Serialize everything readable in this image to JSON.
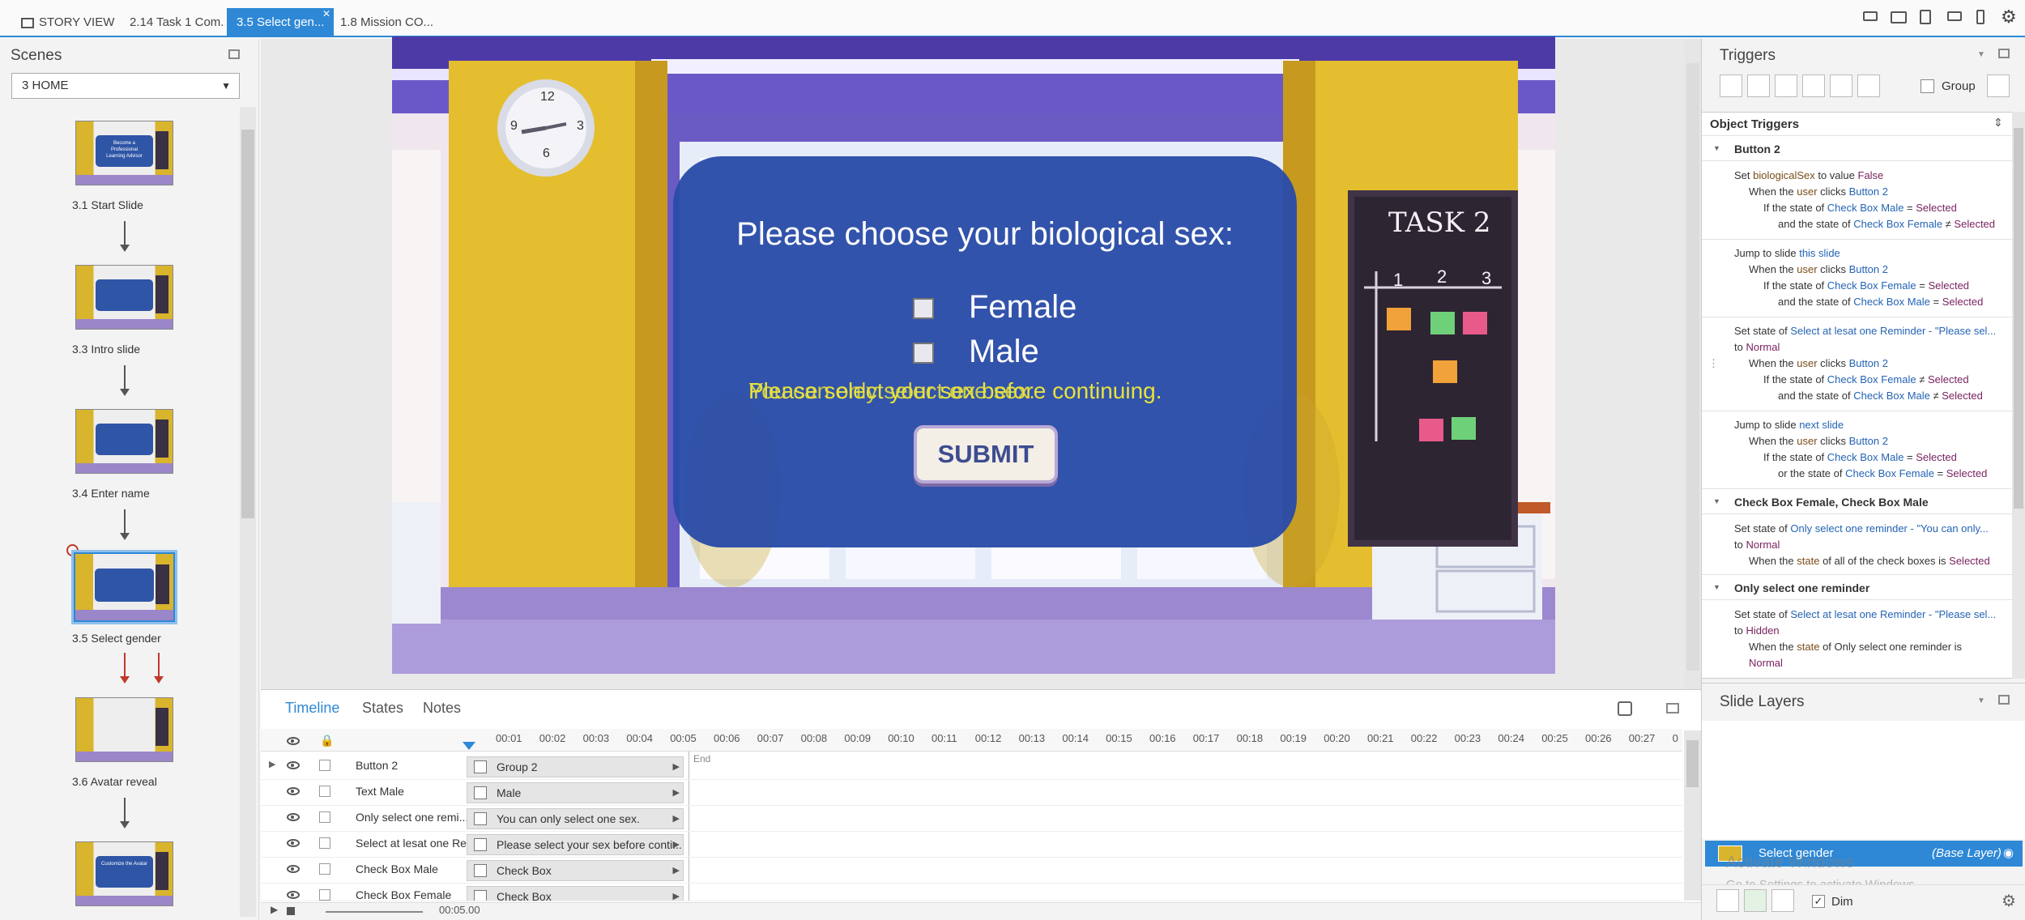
{
  "tabs": [
    {
      "label": "STORY VIEW"
    },
    {
      "label": "2.14 Task 1 Com..."
    },
    {
      "label": "3.5 Select gen..."
    },
    {
      "label": "1.8 Mission CO..."
    }
  ],
  "scenes": {
    "title": "Scenes",
    "dropdown_value": "3 HOME",
    "slides": [
      {
        "label": "3.1 Start Slide"
      },
      {
        "label": "3.3 Intro slide"
      },
      {
        "label": "3.4 Enter name"
      },
      {
        "label": "3.5 Select gender"
      },
      {
        "label": "3.6 Avatar reveal"
      },
      {
        "label": ""
      }
    ],
    "thumb_texts": [
      "Become a Professional Learning Advisor",
      "Customize the Avatar"
    ]
  },
  "slide": {
    "question": "Please choose your biological sex:",
    "options": [
      "Female",
      "Male"
    ],
    "reminder_a": "Please select your sex before continuing.",
    "reminder_b": "You can only select one sex.",
    "submit": "SUBMIT",
    "board_title": "TASK 2",
    "board_cols": [
      "1",
      "2",
      "3"
    ],
    "clock_numbers": [
      "12",
      "3",
      "6",
      "9"
    ]
  },
  "timeline": {
    "tabs": [
      "Timeline",
      "States",
      "Notes"
    ],
    "ticks": [
      "00:01",
      "00:02",
      "00:03",
      "00:04",
      "00:05",
      "00:06",
      "00:07",
      "00:08",
      "00:09",
      "00:10",
      "00:11",
      "00:12",
      "00:13",
      "00:14",
      "00:15",
      "00:16",
      "00:17",
      "00:18",
      "00:19",
      "00:20",
      "00:21",
      "00:22",
      "00:23",
      "00:24",
      "00:25",
      "00:26",
      "00:27",
      "0"
    ],
    "end_label": "End",
    "duration": "00:05.00",
    "rows": [
      {
        "name": "Button 2",
        "bar": "Group 2"
      },
      {
        "name": "Text Male",
        "bar": "Male"
      },
      {
        "name": "Only select one remi...",
        "bar": "You can only select one sex."
      },
      {
        "name": "Select at lesat one Re...",
        "bar": "Please select your sex before conti..."
      },
      {
        "name": "Check Box Male",
        "bar": "Check Box"
      },
      {
        "name": "Check Box Female",
        "bar": "Check Box"
      }
    ]
  },
  "triggers": {
    "title": "Triggers",
    "group_label": "Group",
    "object_triggers": "Object Triggers",
    "sec1": "Button 2",
    "t1": {
      "a": "Set ",
      "b": "biologicalSex",
      "c": " to value ",
      "d": "False",
      "l2a": "When the ",
      "l2b": "user",
      "l2c": " clicks ",
      "l2d": "Button 2",
      "l3a": "If the state of ",
      "l3b": "Check Box Male",
      "l3c": " = ",
      "l3d": "Selected",
      "l4a": "and the state of ",
      "l4b": "Check Box Female",
      "l4c": " ≠ ",
      "l4d": "Selected"
    },
    "t2": {
      "a": "Jump to slide ",
      "b": "this slide",
      "l2a": "When the ",
      "l2b": "user",
      "l2c": " clicks ",
      "l2d": "Button 2",
      "l3a": "If the state of ",
      "l3b": "Check Box Female",
      "l3c": " = ",
      "l3d": "Selected",
      "l4a": "and the state of ",
      "l4b": "Check Box Male",
      "l4c": " = ",
      "l4d": "Selected"
    },
    "t3": {
      "a": "Set state of ",
      "b": "Select at lesat one Reminder - \"Please sel...",
      "l1b": "to ",
      "l1c": "Normal",
      "l2a": "When the ",
      "l2b": "user",
      "l2c": " clicks ",
      "l2d": "Button 2",
      "l3a": "If the state of ",
      "l3b": "Check Box Female",
      "l3c": " ≠ ",
      "l3d": "Selected",
      "l4a": "and the state of ",
      "l4b": "Check Box Male",
      "l4c": " ≠ ",
      "l4d": "Selected"
    },
    "t4": {
      "a": "Jump to slide ",
      "b": "next slide",
      "l2a": "When the ",
      "l2b": "user",
      "l2c": " clicks ",
      "l2d": "Button 2",
      "l3a": "If the state of ",
      "l3b": "Check Box Male",
      "l3c": " = ",
      "l3d": "Selected",
      "l4a": "or the state of ",
      "l4b": "Check Box Female",
      "l4c": " = ",
      "l4d": "Selected"
    },
    "sec2": "Check Box Female, Check Box Male",
    "t5": {
      "a": "Set state of ",
      "b": "Only select one reminder - \"You can only...",
      "l1b": "to ",
      "l1c": "Normal",
      "l2a": "When the ",
      "l2b": "state",
      "l2c": " of all of the check boxes is ",
      "l2d": "Selected"
    },
    "sec3": "Only select one reminder",
    "t6": {
      "a": "Set state of ",
      "b": "Select at lesat one Reminder - \"Please sel...",
      "l1b": "to ",
      "l1c": "Hidden",
      "l2a": "When the ",
      "l2b": "state",
      "l2c": " of Only select one reminder is",
      "l3": "Normal"
    }
  },
  "layers": {
    "title": "Slide Layers",
    "base_name": "Select gender",
    "base_tag": "(Base Layer)",
    "dim_label": "Dim",
    "watermark1": "Activate Windows",
    "watermark2": "Go to Settings to activate Windows."
  }
}
